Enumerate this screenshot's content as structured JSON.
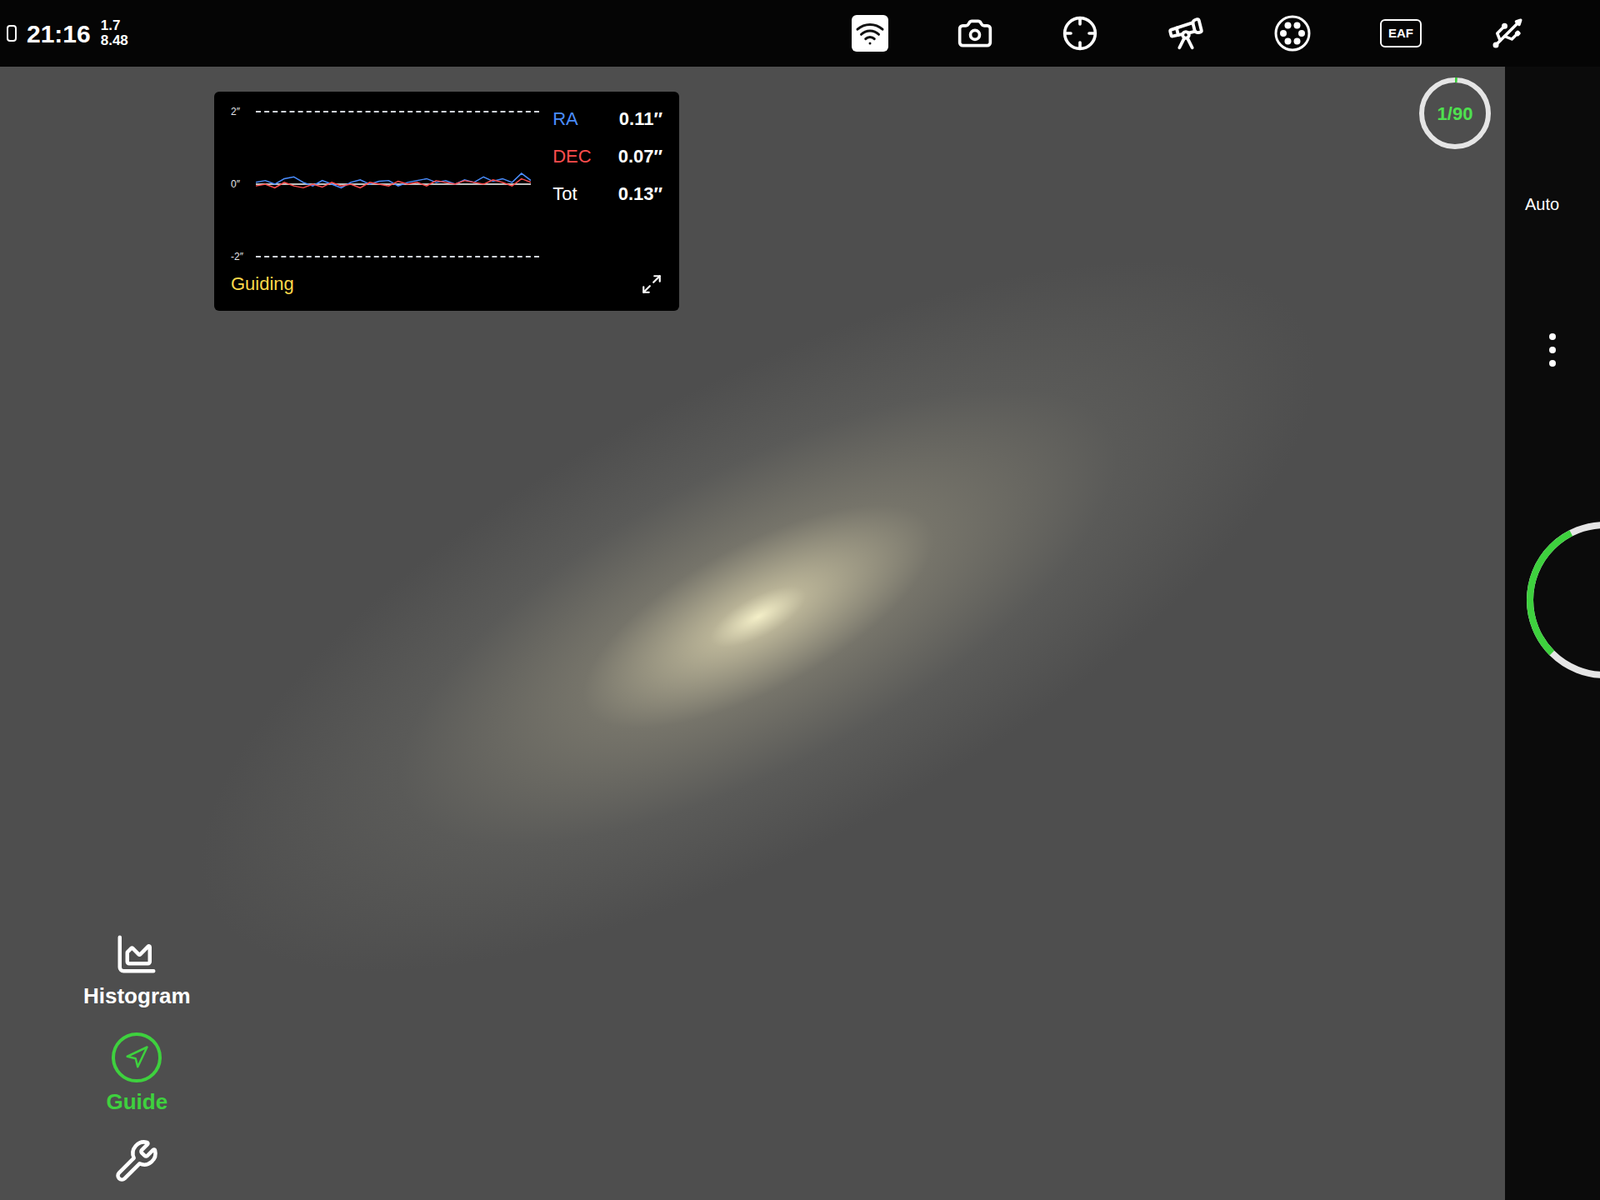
{
  "status_bar": {
    "time": "21:16",
    "reading_top": "1.7",
    "reading_bottom": "8.48"
  },
  "toolbar": {
    "eaf_label": "EAF"
  },
  "guide_graph": {
    "y_ticks": [
      "2″",
      "0″",
      "-2″"
    ],
    "series": [
      {
        "name": "RA",
        "value": "0.11″",
        "color": "#4a8dff",
        "values": [
          0.05,
          0.1,
          0.0,
          0.15,
          0.2,
          0.05,
          -0.05,
          0.1,
          0.0,
          -0.1,
          0.05,
          0.12,
          0.0,
          0.08,
          0.1,
          -0.05,
          0.05,
          0.1,
          0.15,
          0.05,
          0.1,
          0.0,
          0.12,
          0.05,
          0.2,
          0.08,
          0.15,
          0.05,
          0.3,
          0.1
        ]
      },
      {
        "name": "DEC",
        "value": "0.07″",
        "color": "#ff4d4d",
        "values": [
          -0.05,
          0.0,
          -0.1,
          0.05,
          -0.05,
          -0.1,
          0.0,
          -0.08,
          0.05,
          -0.05,
          0.0,
          -0.1,
          0.05,
          0.0,
          -0.05,
          0.08,
          0.0,
          0.05,
          -0.05,
          0.1,
          0.05,
          0.0,
          0.1,
          0.05,
          0.0,
          0.12,
          0.05,
          -0.05,
          0.15,
          0.05
        ]
      }
    ],
    "total": {
      "label": "Tot",
      "value": "0.13″"
    },
    "status": "Guiding"
  },
  "progress": {
    "text": "1/90",
    "level": 0.011
  },
  "side_panel": {
    "label": "Auto",
    "ring_level": 0.3
  },
  "tools": [
    {
      "label": "Histogram",
      "selected": false
    },
    {
      "label": "Guide",
      "selected": true
    }
  ]
}
